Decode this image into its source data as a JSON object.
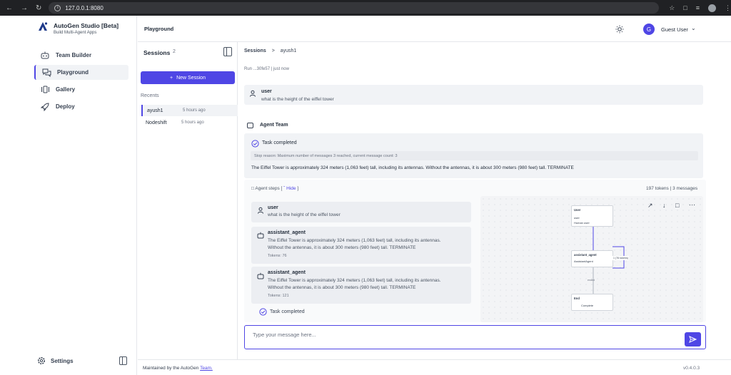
{
  "browser": {
    "url": "127.0.0.1:8080"
  },
  "brand": {
    "title": "AutoGen Studio [Beta]",
    "subtitle": "Build Multi-Agent Apps"
  },
  "nav": [
    {
      "label": "Team Builder"
    },
    {
      "label": "Playground"
    },
    {
      "label": "Gallery"
    },
    {
      "label": "Deploy"
    }
  ],
  "settings_label": "Settings",
  "header": {
    "title": "Playground",
    "user_initial": "G",
    "user_name": "Guest User"
  },
  "sessions": {
    "title": "Sessions",
    "count": "2",
    "new_label": "New Session",
    "recents_label": "Recents",
    "items": [
      {
        "name": "ayush1",
        "time": "5 hours ago"
      },
      {
        "name": "Nodeshift",
        "time": "5 hours ago"
      }
    ]
  },
  "breadcrumb": {
    "root": "Sessions",
    "sep": ">",
    "current": "ayush1"
  },
  "run_info": "Run ...30fe57 | just now",
  "user_msg": {
    "role": "user",
    "text": "what is the height of the eiffel tower"
  },
  "team": {
    "label": "Agent Team",
    "status": "Task completed",
    "stop_reason": "Stop reason: Maximum number of messages 3 reached, current message count: 3",
    "answer": "The Eiffel Tower is approximately 324 meters (1,063 feet) tall, including its antennas. Without the antennas, it is about 300 meters (980 feet) tall. TERMINATE"
  },
  "steps": {
    "label": "Agent steps [",
    "hide": "Hide",
    "close": "]",
    "tokens": "197 tokens | 3 messages",
    "items": [
      {
        "role": "user",
        "text": "what is the height of the eiffel tower",
        "tokens": ""
      },
      {
        "role": "assistant_agent",
        "text1": "The Eiffel Tower is approximately 324 meters (1,063 feet) tall, including its antennas.",
        "text2": "Without the antennas, it is about 300 meters (980 feet) tall. TERMINATE",
        "tokens": "Tokens: 76"
      },
      {
        "role": "assistant_agent",
        "text1": "The Eiffel Tower is approximately 324 meters (1,063 feet) tall, including its antennas.",
        "text2": "Without the antennas, it is about 300 meters (980 feet) tall. TERMINATE",
        "tokens": "Tokens: 121"
      }
    ],
    "done": "Task completed"
  },
  "graph": {
    "user_node": {
      "title": "User",
      "l1": "user",
      "l2": "Human user"
    },
    "agent_node": {
      "title": "assistant_agent",
      "l1": "AssistantAgent"
    },
    "end_node": {
      "title": "End",
      "l1": "Complete"
    },
    "edge_label": "1 (76 tokens)",
    "end_edge": "ended"
  },
  "input": {
    "placeholder": "Type your message here..."
  },
  "footer": {
    "left": "Maintained by the AutoGen ",
    "link": "Team.",
    "version": "v0.4.0.3"
  },
  "colors": {
    "accent": "#4f46e5",
    "panel": "#f1f3f6"
  }
}
